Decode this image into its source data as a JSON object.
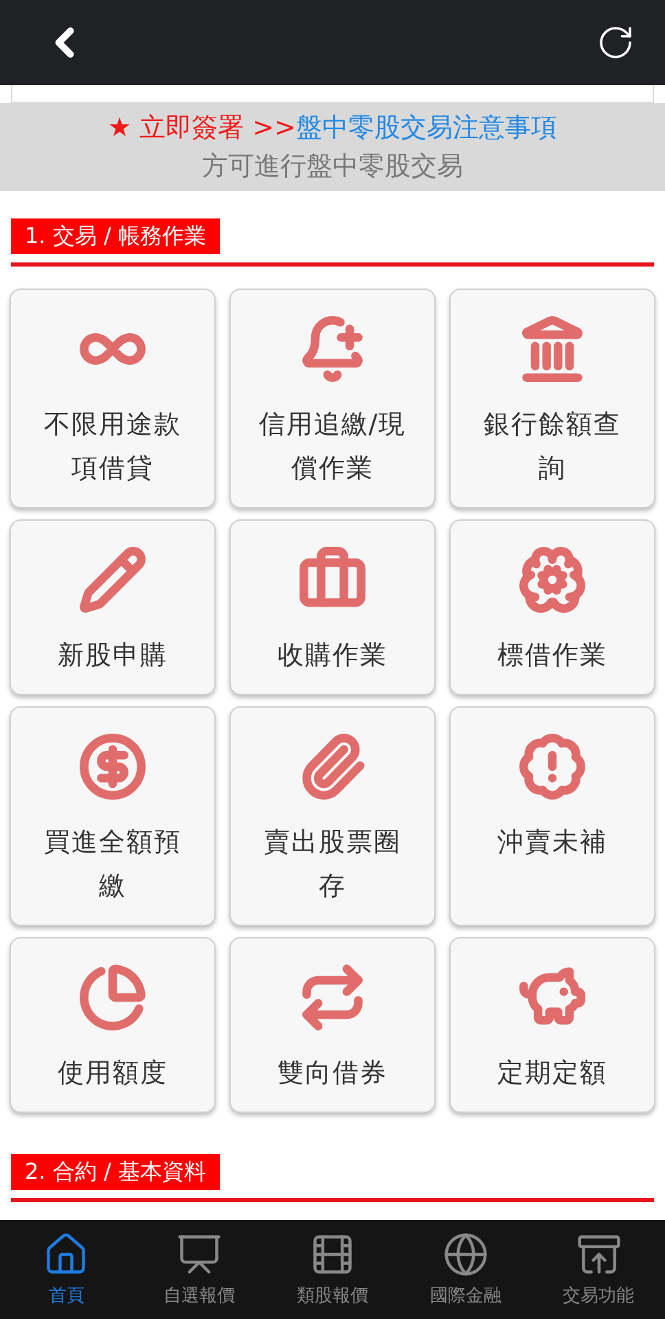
{
  "banner": {
    "prefix": "★ 立即簽署 >>",
    "link": "盤中零股交易注意事項",
    "note": "方可進行盤中零股交易"
  },
  "sections": [
    {
      "title": "1. 交易 / 帳務作業",
      "tiles": [
        {
          "label": "不限用途款項借貸"
        },
        {
          "label": "信用追繳/現償作業"
        },
        {
          "label": "銀行餘額查詢"
        },
        {
          "label": "新股申購"
        },
        {
          "label": "收購作業"
        },
        {
          "label": "標借作業"
        },
        {
          "label": "買進全額預繳"
        },
        {
          "label": "賣出股票圈存"
        },
        {
          "label": "沖賣未補"
        },
        {
          "label": "使用額度"
        },
        {
          "label": "雙向借券"
        },
        {
          "label": "定期定額"
        }
      ]
    },
    {
      "title": "2. 合約 / 基本資料"
    }
  ],
  "nav": [
    {
      "label": "首頁",
      "selected": true
    },
    {
      "label": "自選報價",
      "selected": false
    },
    {
      "label": "類股報價",
      "selected": false
    },
    {
      "label": "國際金融",
      "selected": false
    },
    {
      "label": "交易功能",
      "selected": false
    }
  ]
}
